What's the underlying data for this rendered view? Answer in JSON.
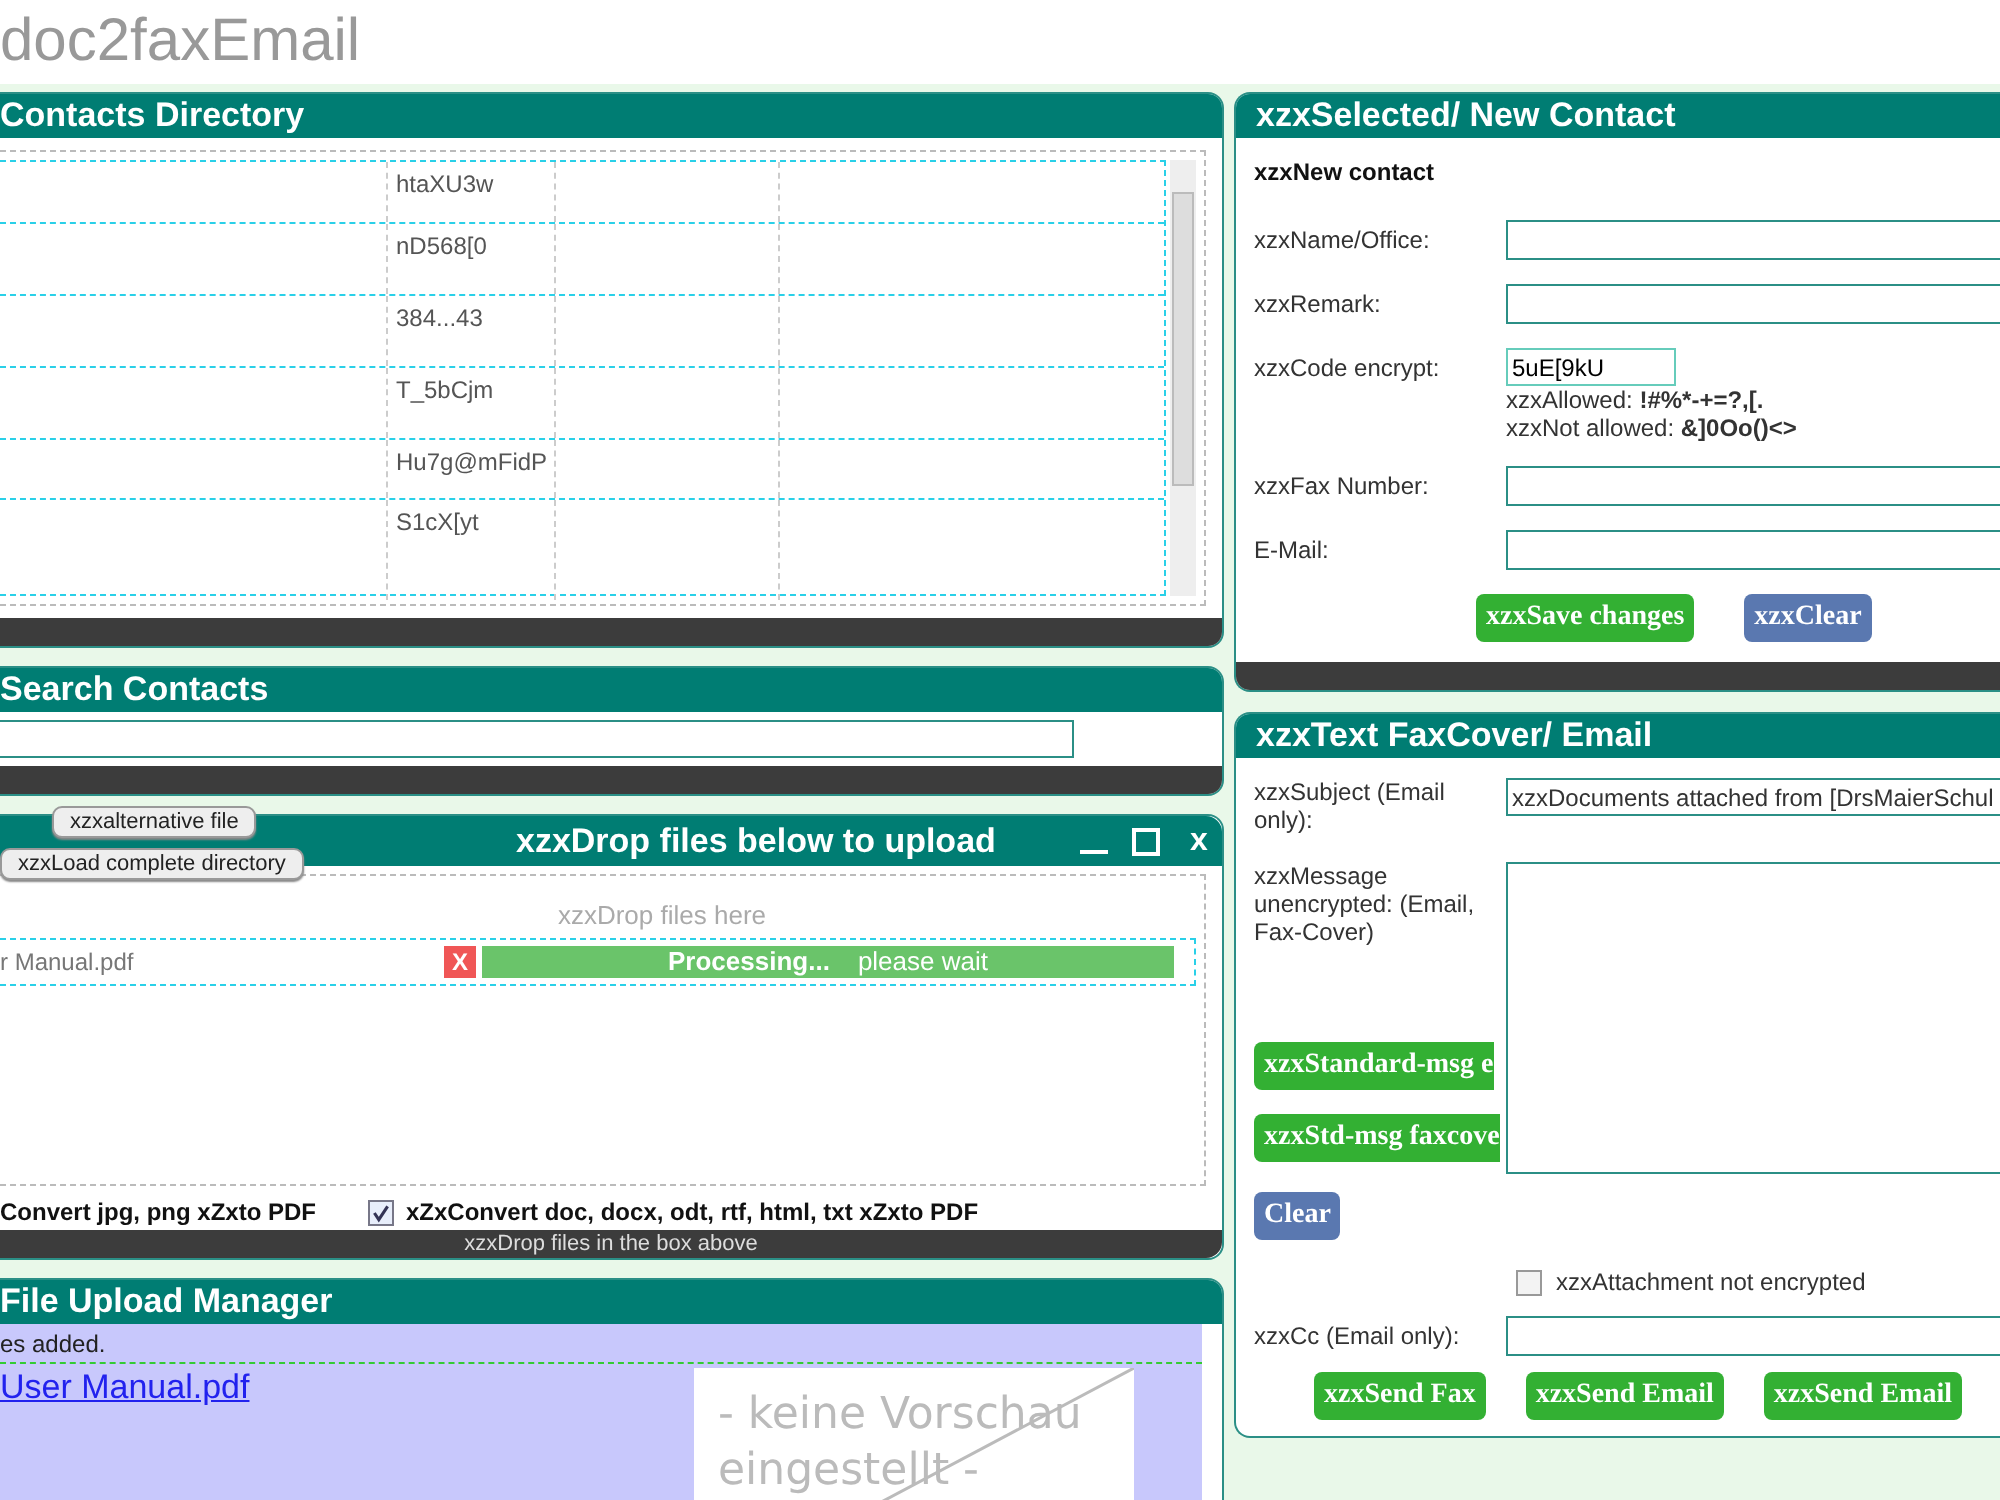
{
  "app_title": "doc2faxEmail",
  "contacts": {
    "title": "Contacts Directory",
    "rows": [
      {
        "code": "htaXU3w"
      },
      {
        "code": "nD568[0"
      },
      {
        "code": "384...43"
      },
      {
        "code": "T_5bCjm"
      },
      {
        "code": "Hu7g@mFidP"
      },
      {
        "code": "S1cX[yt"
      }
    ]
  },
  "search": {
    "title": "Search Contacts"
  },
  "drop": {
    "title": "xzxDrop files below to upload",
    "close": "x",
    "buttons": [
      "xzxalternative file",
      "xzxLoad complete directory"
    ],
    "hint": "xzxDrop files here",
    "files": [
      {
        "name": "r Manual.pdf",
        "remove": "X",
        "status": "Processing...",
        "note": "please wait",
        "level": 1
      }
    ],
    "convert_images": "Convert jpg, png xZxto PDF",
    "convert_docs": {
      "label": "xZxConvert doc, docx, odt, rtf, html, txt xZxto PDF",
      "checked": true
    },
    "footer": "xzxDrop files in the box above"
  },
  "upload_manager": {
    "title": "File Upload Manager",
    "status": "es added.",
    "files": [
      {
        "name": "User Manual.pdf",
        "preview": [
          "- keine Vorschau",
          "eingestellt -"
        ]
      }
    ]
  },
  "contact_form": {
    "title": "xzxSelected/ New Contact",
    "subtitle": "xzxNew contact",
    "fields": [
      {
        "kind": "text",
        "label": "xzxName/Office:"
      },
      {
        "kind": "text",
        "label": "xzxRemark:"
      },
      {
        "kind": "code",
        "label": "xzxCode encrypt:",
        "value": "5uE[9kU",
        "allowed_label": "xzxAllowed:",
        "allowed": "!#%*-+=?,[.",
        "not_allowed_label": "xzxNot allowed:",
        "not_allowed": "&]0Oo()<>"
      },
      {
        "kind": "text",
        "label": "xzxFax Number:"
      },
      {
        "kind": "text",
        "label": "E-Mail:"
      }
    ],
    "buttons": [
      {
        "label": "xzxSave changes",
        "kind": "primary"
      },
      {
        "label": "xzxClear",
        "kind": "secondary"
      }
    ]
  },
  "cover": {
    "title": "xzxText FaxCover/ Email",
    "subject_label": "xzxSubject (Email only):",
    "subject": "xzxDocuments attached from [DrsMaierSchul",
    "message_label": "xzxMessage unencrypted: (Email, Fax-Cover)",
    "template_buttons": [
      "xzxStandard-msg e",
      "xzxStd-msg faxcove"
    ],
    "clear": "Clear",
    "attachment": {
      "label": "xzxAttachment not encrypted",
      "checked": false
    },
    "cc_label": "xzxCc (Email only):",
    "send_buttons": [
      "xzxSend Fax",
      "xzxSend Email",
      "xzxSend Email"
    ]
  }
}
